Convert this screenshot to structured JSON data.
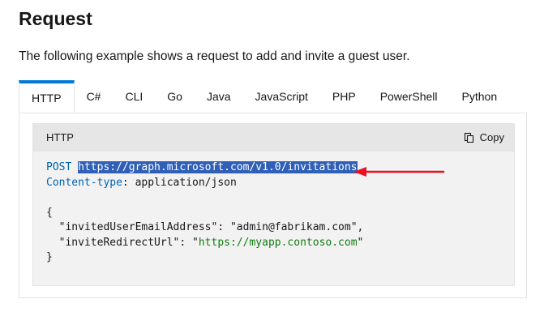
{
  "page": {
    "heading": "Request",
    "intro": "The following example shows a request to add and invite a guest user."
  },
  "tabs": [
    {
      "label": "HTTP",
      "active": true
    },
    {
      "label": "C#",
      "active": false
    },
    {
      "label": "CLI",
      "active": false
    },
    {
      "label": "Go",
      "active": false
    },
    {
      "label": "Java",
      "active": false
    },
    {
      "label": "JavaScript",
      "active": false
    },
    {
      "label": "PHP",
      "active": false
    },
    {
      "label": "PowerShell",
      "active": false
    },
    {
      "label": "Python",
      "active": false
    }
  ],
  "code_block": {
    "language_label": "HTTP",
    "copy_label": "Copy",
    "copy_icon": "copy-icon",
    "method": "POST",
    "url": "https://graph.microsoft.com/v1.0/invitations",
    "header_name": "Content-type",
    "header_value": "application/json",
    "body_open": "{",
    "line1_key": "\"invitedUserEmailAddress\"",
    "line1_value": "\"admin@fabrikam.com\"",
    "line2_key": "\"inviteRedirectUrl\"",
    "line2_value_quote_open": "\"",
    "line2_value_url": "https://myapp.contoso.com",
    "line2_value_quote_close": "\"",
    "body_close": "}"
  },
  "colors": {
    "accent": "#0078d4",
    "selection": "#2f5fb7",
    "annotation_arrow": "#e81123",
    "keyword": "#0063b1",
    "link_string": "#107c10"
  }
}
